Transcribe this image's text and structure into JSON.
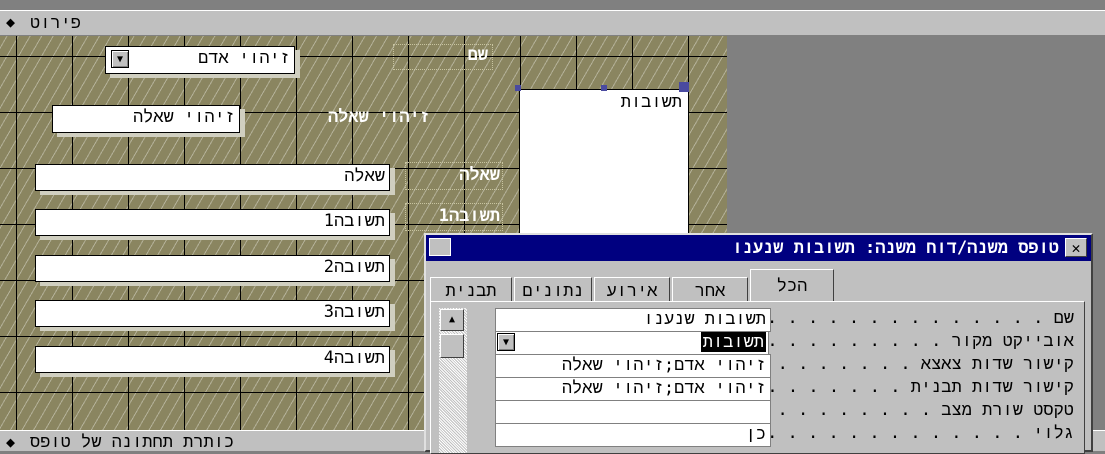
{
  "detail_bar": {
    "label": "פירוט"
  },
  "footer_bar": {
    "label": "כותרת תחתונה של טופס"
  },
  "form": {
    "combo_value": "זיהוי אדם",
    "question_id_field": "זיהוי שאלה",
    "labels": {
      "name": "שם",
      "question_id": "זיהוי שאלה",
      "question": "שאלה",
      "answer1": "תשובה1"
    },
    "fields": [
      "שאלה",
      "תשובה1",
      "תשובה2",
      "תשובה3",
      "תשובה4"
    ],
    "subform_label": "תשובות"
  },
  "dialog": {
    "title": "טופס משנה/דוח משנה: תשובות שנענו",
    "tabs": [
      "הכל",
      "אחר",
      "אירוע",
      "נתונים",
      "תבנית"
    ],
    "active_tab": "הכל",
    "properties": [
      {
        "name": "שם",
        "value": "תשובות שנענו"
      },
      {
        "name": "אובייקט מקור",
        "value": "תשובות"
      },
      {
        "name": "קישור שדות צאצא",
        "value": "זיהוי אדם;זיהוי שאלה"
      },
      {
        "name": "קישור שדות תבנית",
        "value": "זיהוי אדם;זיהוי שאלה"
      },
      {
        "name": "טקסט שורת מצב",
        "value": ""
      },
      {
        "name": "גלוי",
        "value": "כן"
      }
    ]
  },
  "colors": {
    "title_bar": "#000080",
    "grid_background": "#8a8560",
    "chrome": "#c0c0c0"
  }
}
